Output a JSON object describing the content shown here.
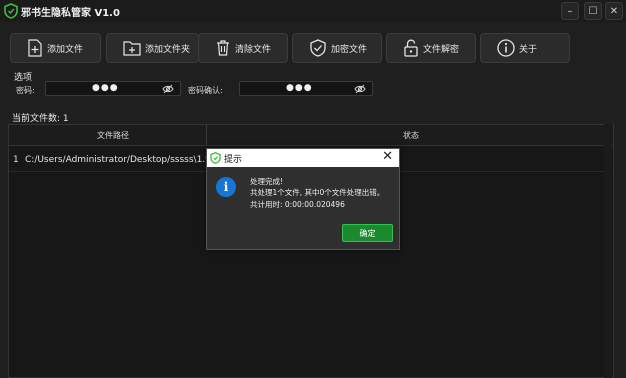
{
  "window": {
    "title": "邪书生隐私管家 V1.0",
    "controls": {
      "minimize": "–",
      "maximize": "☐",
      "close": "✕"
    }
  },
  "toolbar": {
    "buttons": [
      {
        "label": "添加文件",
        "icon": "add-file-icon"
      },
      {
        "label": "添加文件夹",
        "icon": "add-folder-icon"
      },
      {
        "label": "清除文件",
        "icon": "clear-icon"
      },
      {
        "label": "加密文件",
        "icon": "shield-check-icon"
      },
      {
        "label": "文件解密",
        "icon": "unlock-icon"
      },
      {
        "label": "关于",
        "icon": "info-icon"
      }
    ]
  },
  "options": {
    "section_title": "选项",
    "password_label": "密码:",
    "password_value": "●●●",
    "confirm_label": "密码确认:",
    "confirm_value": "●●●"
  },
  "file_list": {
    "count_label": "当前文件数: 1",
    "columns": [
      "文件路径",
      "状态"
    ],
    "rows": [
      {
        "index": "1",
        "path": "C:/Users/Administrator/Desktop/sssss\\1.txt",
        "status": ""
      }
    ]
  },
  "dialog": {
    "title": "提示",
    "lines": [
      "处理完成!",
      "共处理1个文件, 其中0个文件处理出错。",
      "共计用时: 0:00:00.020496"
    ],
    "ok_label": "确定"
  },
  "colors": {
    "background": "#1f1f1f",
    "accent_green": "#1b8a2e",
    "info_blue": "#1577d3",
    "logo_green": "#3fbf3f"
  }
}
